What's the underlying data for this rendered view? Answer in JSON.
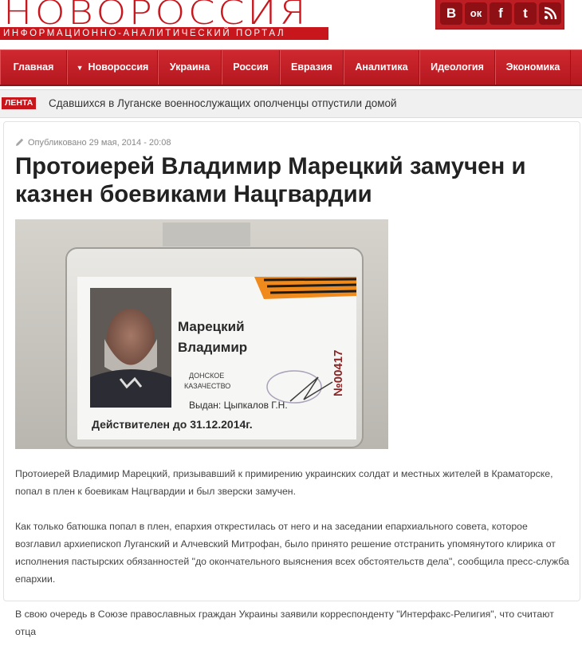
{
  "header": {
    "logo_title": "НОВОРОССИЯ",
    "logo_subtitle": "ИНФОРМАЦИОННО-АНАЛИТИЧЕСКИЙ ПОРТАЛ",
    "social": [
      {
        "icon": "vk-icon",
        "glyph": "В"
      },
      {
        "icon": "odnoklassniki-icon",
        "glyph": "ок"
      },
      {
        "icon": "facebook-icon",
        "glyph": "f"
      },
      {
        "icon": "twitter-icon",
        "glyph": "t"
      },
      {
        "icon": "rss-icon",
        "glyph": "rss"
      }
    ]
  },
  "nav": {
    "items": [
      {
        "label": "Главная"
      },
      {
        "label": "Новороссия",
        "has_dropdown": true
      },
      {
        "label": "Украина"
      },
      {
        "label": "Россия"
      },
      {
        "label": "Евразия"
      },
      {
        "label": "Аналитика"
      },
      {
        "label": "Идеология"
      },
      {
        "label": "Экономика"
      }
    ]
  },
  "ticker": {
    "badge": "ЛЕНТА",
    "text": "Сдавшихся в Луганске военнослужащих ополченцы отпустили домой"
  },
  "article": {
    "meta": "Опубликовано 29 мая, 2014 - 20:08",
    "title": "Протоиерей Владимир Марецкий замучен и казнен боевиками Нацгвардии",
    "photo": {
      "surname": "Марецкий",
      "name": "Владимир",
      "org_line1": "ДОНСКОЕ",
      "org_line2": "КАЗАЧЕСТВО",
      "issued": "Выдан: Цыпкалов Г.Н.",
      "valid": "Действителен до 31.12.2014г.",
      "number": "№00417"
    },
    "paragraphs": [
      "Протоиерей Владимир Марецкий, призывавший к примирению украинских солдат и местных жителей в Краматорске, попал в плен к боевикам Нацгвардии и был зверски замучен.",
      "Как только батюшка попал в плен, епархия открестилась от него и на заседании епархиального совета, которое возглавил архиепископ Луганский и Алчевский Митрофан, было принято решение отстранить упомянутого клирика от исполнения пастырских обязанностей \"до окончательного выяснения всех обстоятельств дела\", сообщила пресс-служба епархии.",
      "В свою очередь в Союзе православных граждан Украины заявили корреспонденту \"Интерфакс-Религия\", что считают отца"
    ]
  },
  "colors": {
    "brand_red": "#c8161d",
    "nav_red": "#c0141b",
    "text": "#444444",
    "title": "#222222"
  }
}
